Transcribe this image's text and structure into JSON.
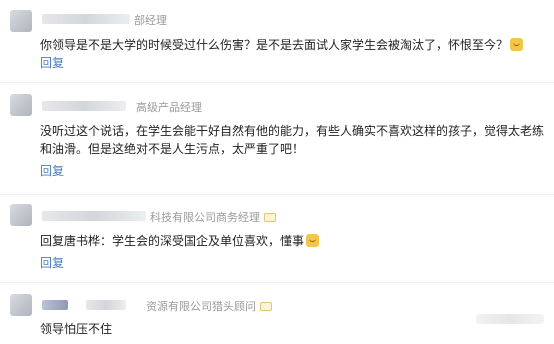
{
  "comments": [
    {
      "author_suffix": "部经理",
      "text": "你领导是不是大学的时候受过什么伤害？是不是去面试人家学生会被淘汰了，怀恨至今？",
      "reply_label": "回复"
    },
    {
      "author_suffix": "高级产品经理",
      "text": "没听过这个说话，在学生会能干好自然有他的能力，有些人确实不喜欢这样的孩子，觉得太老练和油滑。但是这绝对不是人生污点，太严重了吧！",
      "reply_label": "回复"
    },
    {
      "author_suffix": "科技有限公司商务经理",
      "text": "回复唐书桦：学生会的深受国企及单位喜欢，懂事",
      "reply_label": "回复"
    },
    {
      "author_suffix": "资源有限公司猎头顾问",
      "text": "领导怕压不住"
    }
  ]
}
